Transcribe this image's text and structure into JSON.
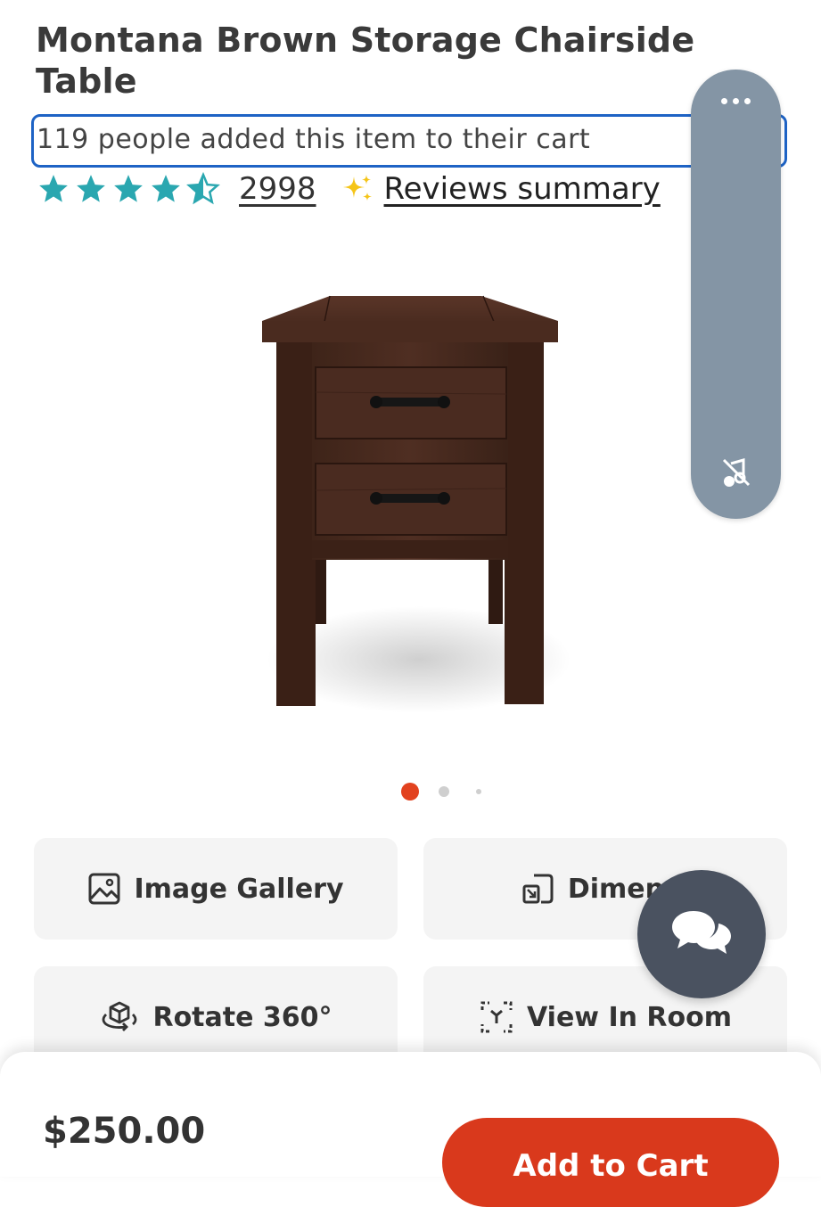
{
  "product": {
    "title": "Montana Brown Storage Chairside Table",
    "cart_notice": "119 people added this item to their cart",
    "rating": 4.5,
    "review_count": "2998",
    "reviews_summary_label": "Reviews summary"
  },
  "gallery": {
    "total_images": 3,
    "active_index": 0
  },
  "actions": {
    "image_gallery": "Image Gallery",
    "dimensions": "Dimensi",
    "rotate": "Rotate 360°",
    "view_in_room": "View In Room"
  },
  "footer": {
    "price": "$250.00",
    "add_to_cart": "Add to Cart"
  },
  "icons": {
    "star": "star-icon",
    "sparkle": "sparkle-icon",
    "more": "more-icon",
    "mute": "music-off-icon",
    "chat": "chat-icon",
    "gallery": "image-icon",
    "dimensions": "resize-icon",
    "rotate": "cube-rotate-icon",
    "ar": "ar-view-icon"
  },
  "colors": {
    "star": "#2aa7b0",
    "accent": "#d9391c",
    "focus_outline": "#1e63c5",
    "side_pill": "#8495a5",
    "chat_fab": "#4a5260"
  }
}
